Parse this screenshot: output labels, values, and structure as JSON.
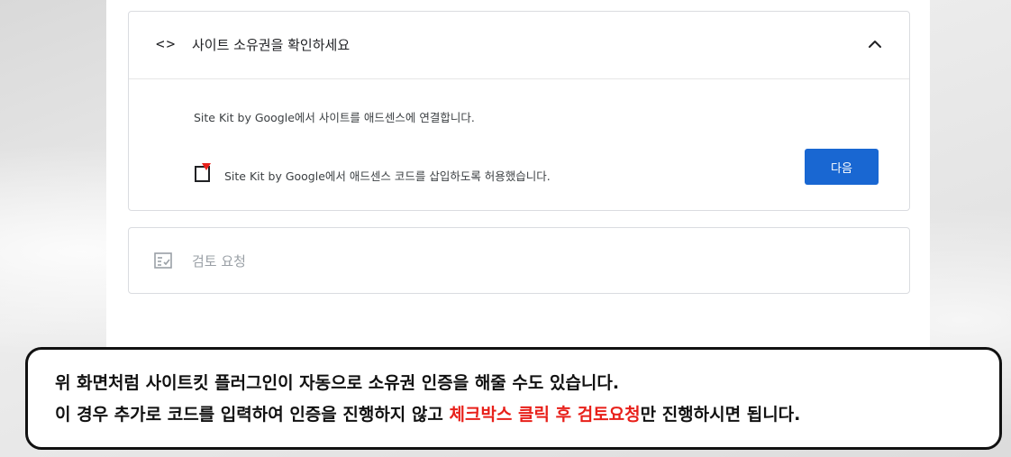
{
  "card": {
    "code_icon": "<>",
    "title": "사이트 소유권을 확인하세요",
    "chevron_icon": "chevron-up-icon",
    "description": "Site Kit by Google에서 사이트를 애드센스에 연결합니다.",
    "checkbox_label": "Site Kit by Google에서 애드센스 코드를 삽입하도록 허용했습니다.",
    "checkbox_checked": false,
    "next_button": "다음"
  },
  "review": {
    "icon": "review-checklist-icon",
    "title": "검토 요청"
  },
  "caption": {
    "line1": "위 화면처럼 사이트킷 플러그인이 자동으로 소유권 인증을 해줄 수도 있습니다.",
    "line2_before": "이 경우 추가로 코드를 입력하여 인증을 진행하지 않고 ",
    "line2_highlight": "체크박스 클릭 후 검토요청",
    "line2_after": "만 진행하시면 됩니다."
  },
  "colors": {
    "accent_button": "#1967d2",
    "highlight_text": "#e8201a",
    "checkbox_marker": "#e8201a"
  }
}
